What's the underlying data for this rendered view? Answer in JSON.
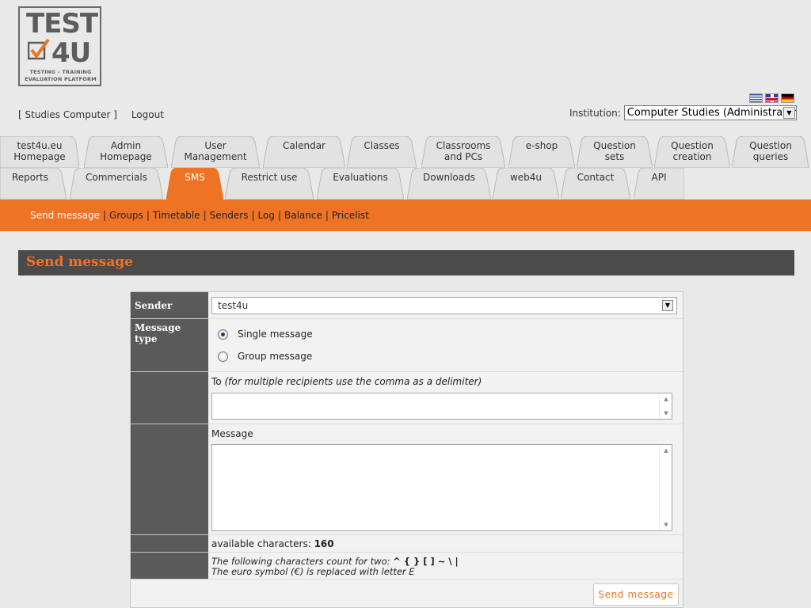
{
  "logo": {
    "line1": "TEST",
    "line2": "4U",
    "tagline1": "TESTING – TRAINING",
    "tagline2": "EVALUATION PLATFORM"
  },
  "top": {
    "user_link": "[ Studies Computer ]",
    "logout": "Logout"
  },
  "flags": [
    "greek-flag-icon",
    "uk-flag-icon",
    "german-flag-icon"
  ],
  "institution": {
    "label": "Institution:",
    "value": "Computer Studies (Administrator)"
  },
  "tabs_row1": [
    {
      "label1": "test4u.eu",
      "label2": "Homepage"
    },
    {
      "label1": "Admin",
      "label2": "Homepage"
    },
    {
      "label1": "User",
      "label2": "Management"
    },
    {
      "label1": "Calendar",
      "label2": ""
    },
    {
      "label1": "Classes",
      "label2": ""
    },
    {
      "label1": "Classrooms",
      "label2": "and PCs"
    },
    {
      "label1": "e-shop",
      "label2": ""
    },
    {
      "label1": "Question",
      "label2": "sets"
    },
    {
      "label1": "Question",
      "label2": "creation"
    },
    {
      "label1": "Question",
      "label2": "queries"
    }
  ],
  "tabs_row2": [
    {
      "label1": "Reports"
    },
    {
      "label1": "Commercials"
    },
    {
      "label1": "SMS"
    },
    {
      "label1": "Restrict use"
    },
    {
      "label1": "Evaluations"
    },
    {
      "label1": "Downloads"
    },
    {
      "label1": "web4u"
    },
    {
      "label1": "Contact"
    },
    {
      "label1": "API"
    }
  ],
  "subnav": [
    "Send message",
    "Groups",
    "Timetable",
    "Senders",
    "Log",
    "Balance",
    "Pricelist"
  ],
  "page_title": "Send message",
  "form": {
    "sender_label": "Sender",
    "sender_value": "test4u",
    "type_label": "Message type",
    "type_single": "Single message",
    "type_group": "Group message",
    "to_label": "To",
    "to_hint": "(for multiple recipients use the comma as a delimiter)",
    "message_label": "Message",
    "avail_label": "available characters:",
    "avail_value": "160",
    "note1": "The following characters count for two:",
    "note1_chars": "^ { } [ ] ~ \\ |",
    "note2": "The euro symbol (€) is replaced with letter E",
    "send_button": "Send message"
  },
  "colors": {
    "accent": "#ef7324",
    "dark": "#4b4b4b",
    "label_bg": "#5a5a5a"
  }
}
